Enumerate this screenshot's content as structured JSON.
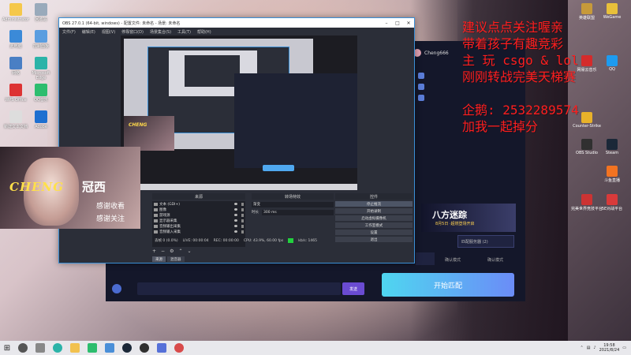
{
  "obs": {
    "title": "OBS 27.0.1 (64-bit, windows) - 配置文件: 未命名 - 场景: 未命名",
    "menu": [
      "文件(F)",
      "编辑(E)",
      "视图(V)",
      "停靠窗口(D)",
      "场景集合(S)",
      "工具(T)",
      "帮助(H)"
    ],
    "docks": {
      "scenes": "场景",
      "sources": "来源",
      "mixer": "音频混音器",
      "transitions": "转场特效",
      "controls": "控件"
    },
    "sources": [
      "文本 (GDI+)",
      "图像",
      "游戏源",
      "显示器采集",
      "音频输出采集",
      "音频输入采集"
    ],
    "transition_name": "渐变",
    "duration_label": "时长",
    "duration_value": "300 ms",
    "controls": [
      "停止推流",
      "开始录制",
      "启动虚拟摄像机",
      "工作室模式",
      "设置",
      "退出"
    ],
    "tabs": [
      "来源",
      "混音器"
    ],
    "status": {
      "dropped": "丢帧 0 (0.0%)",
      "live": "LIVE: 00:00:04",
      "rec": "REC: 00:00:00",
      "cpu": "CPU: 43.9%, 60.00 fps",
      "bitrate": "kb/s: 1465"
    }
  },
  "cam": {
    "name": "CHENG",
    "cn_name": "冠西",
    "line1": "感谢收看",
    "line2": "感谢关注"
  },
  "overlay": {
    "lines": [
      "建议点点关注喔亲",
      "带着孩子有趣竞彩",
      "主 玩 csgo & lol",
      "刚刚转战完美天梯赛"
    ],
    "qq": "企鹅: 2532289574",
    "join": "加我一起掉分"
  },
  "game": {
    "username": "Cheng666",
    "banner_title": "八方迷踪",
    "banner_sub": "8月5日 ·超燃登场开启",
    "select_label": "匹配服务器 (2)",
    "opt1": "确认模式",
    "opt2": "确认模式",
    "send": "发送",
    "start_button": "开始匹配"
  },
  "desktop_left": [
    "Administrator",
    "回收站",
    "此电脑",
    "控制面板",
    "网络",
    "Microsoft Edge",
    "WPS Office",
    "QQ音乐",
    "新建文本文档",
    "Adobe"
  ],
  "desktop_right": [
    "英雄联盟",
    "WeGame",
    "网易云音乐",
    "QQ",
    "Counter-Strike",
    "OBS Studio",
    "Steam",
    "斗鱼直播",
    "完美世界竞技平台",
    "5E对战平台"
  ],
  "taskbar": {
    "time": "19:58",
    "date": "2021/8/24"
  },
  "colors": {
    "overlay_red": "#ff1e1e",
    "start_button": "#4fd6f0",
    "obs_accent": "#3a8fd6",
    "cam_gold": "#ffe04a"
  }
}
